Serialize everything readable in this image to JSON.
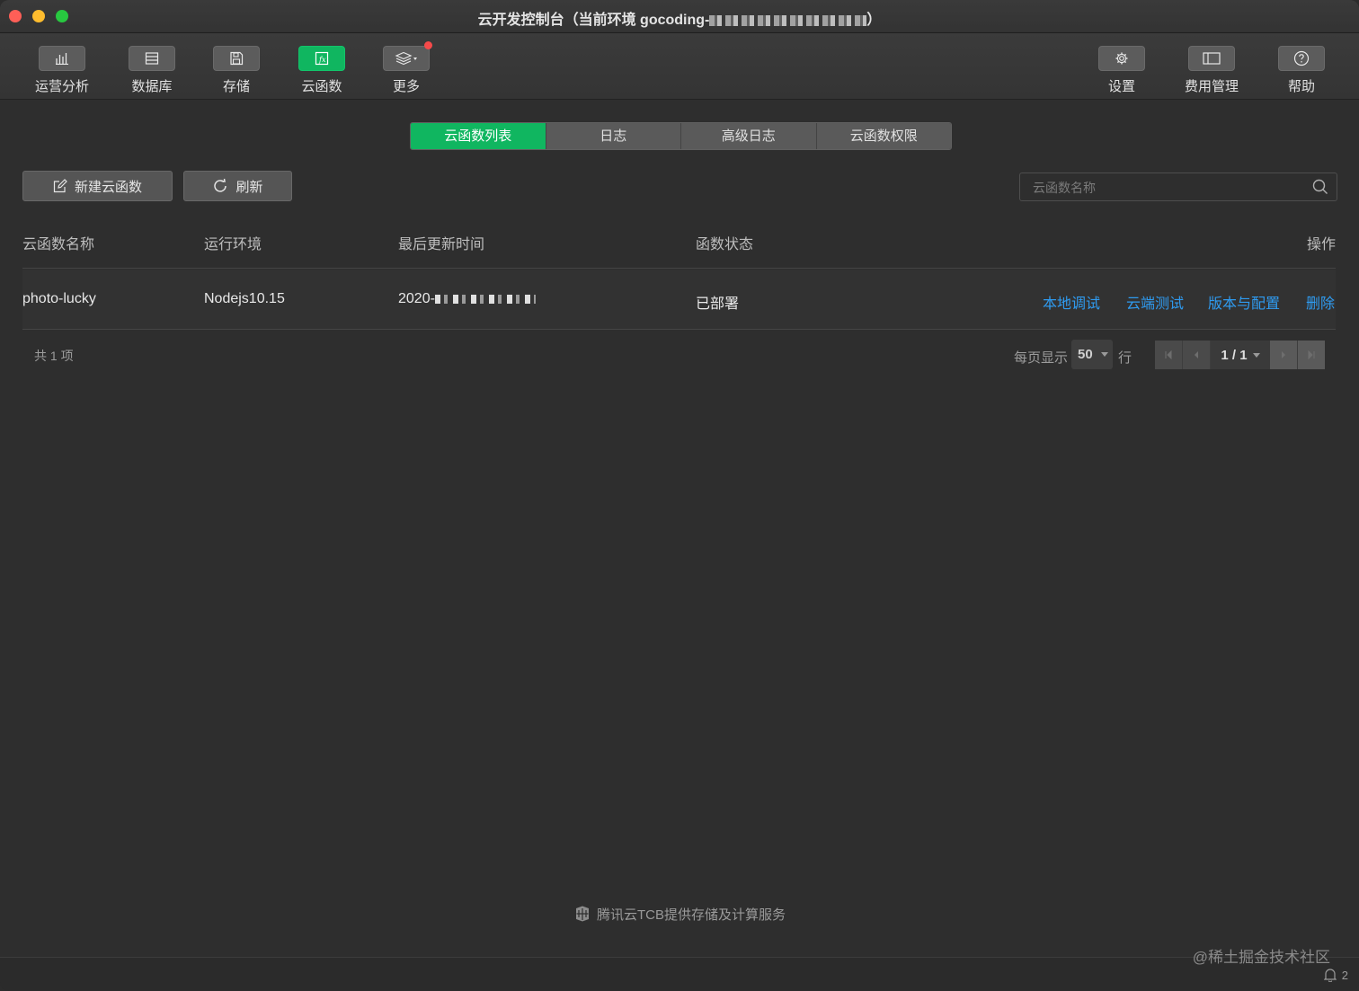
{
  "window": {
    "title": "云开发控制台（当前环境 gocoding-",
    "title_end": "）"
  },
  "toolbar": {
    "left": [
      {
        "label": "运营分析",
        "icon": "bar-chart-icon",
        "active": false
      },
      {
        "label": "数据库",
        "icon": "database-icon",
        "active": false
      },
      {
        "label": "存储",
        "icon": "save-icon",
        "active": false
      },
      {
        "label": "云函数",
        "icon": "function-icon",
        "active": true
      },
      {
        "label": "更多",
        "icon": "layers-icon",
        "active": false,
        "badge": true
      }
    ],
    "right": [
      {
        "label": "设置",
        "icon": "gear-icon"
      },
      {
        "label": "费用管理",
        "icon": "billing-icon"
      },
      {
        "label": "帮助",
        "icon": "help-icon"
      }
    ]
  },
  "tabs": [
    {
      "label": "云函数列表",
      "active": true
    },
    {
      "label": "日志",
      "active": false
    },
    {
      "label": "高级日志",
      "active": false
    },
    {
      "label": "云函数权限",
      "active": false
    }
  ],
  "actions": {
    "new_label": "新建云函数",
    "refresh_label": "刷新"
  },
  "search": {
    "placeholder": "云函数名称"
  },
  "table": {
    "columns": [
      "云函数名称",
      "运行环境",
      "最后更新时间",
      "函数状态",
      "操作"
    ],
    "rows": [
      {
        "name": "photo-lucky",
        "runtime": "Nodejs10.15",
        "updated": "2020-",
        "status": "已部署",
        "ops": [
          "本地调试",
          "云端测试",
          "版本与配置",
          "删除"
        ]
      }
    ]
  },
  "pagination": {
    "total_text": "共 1 项",
    "per_page_label": "每页显示",
    "per_page_value": "50",
    "per_page_suffix": "行",
    "page_text": "1 / 1"
  },
  "footer": {
    "text": "腾讯云TCB提供存储及计算服务"
  },
  "watermark": "@稀土掘金技术社区",
  "notifications": {
    "count": "2"
  },
  "colors": {
    "accent": "#10b660",
    "link": "#2f9bf0",
    "badge": "#f64a4a"
  }
}
